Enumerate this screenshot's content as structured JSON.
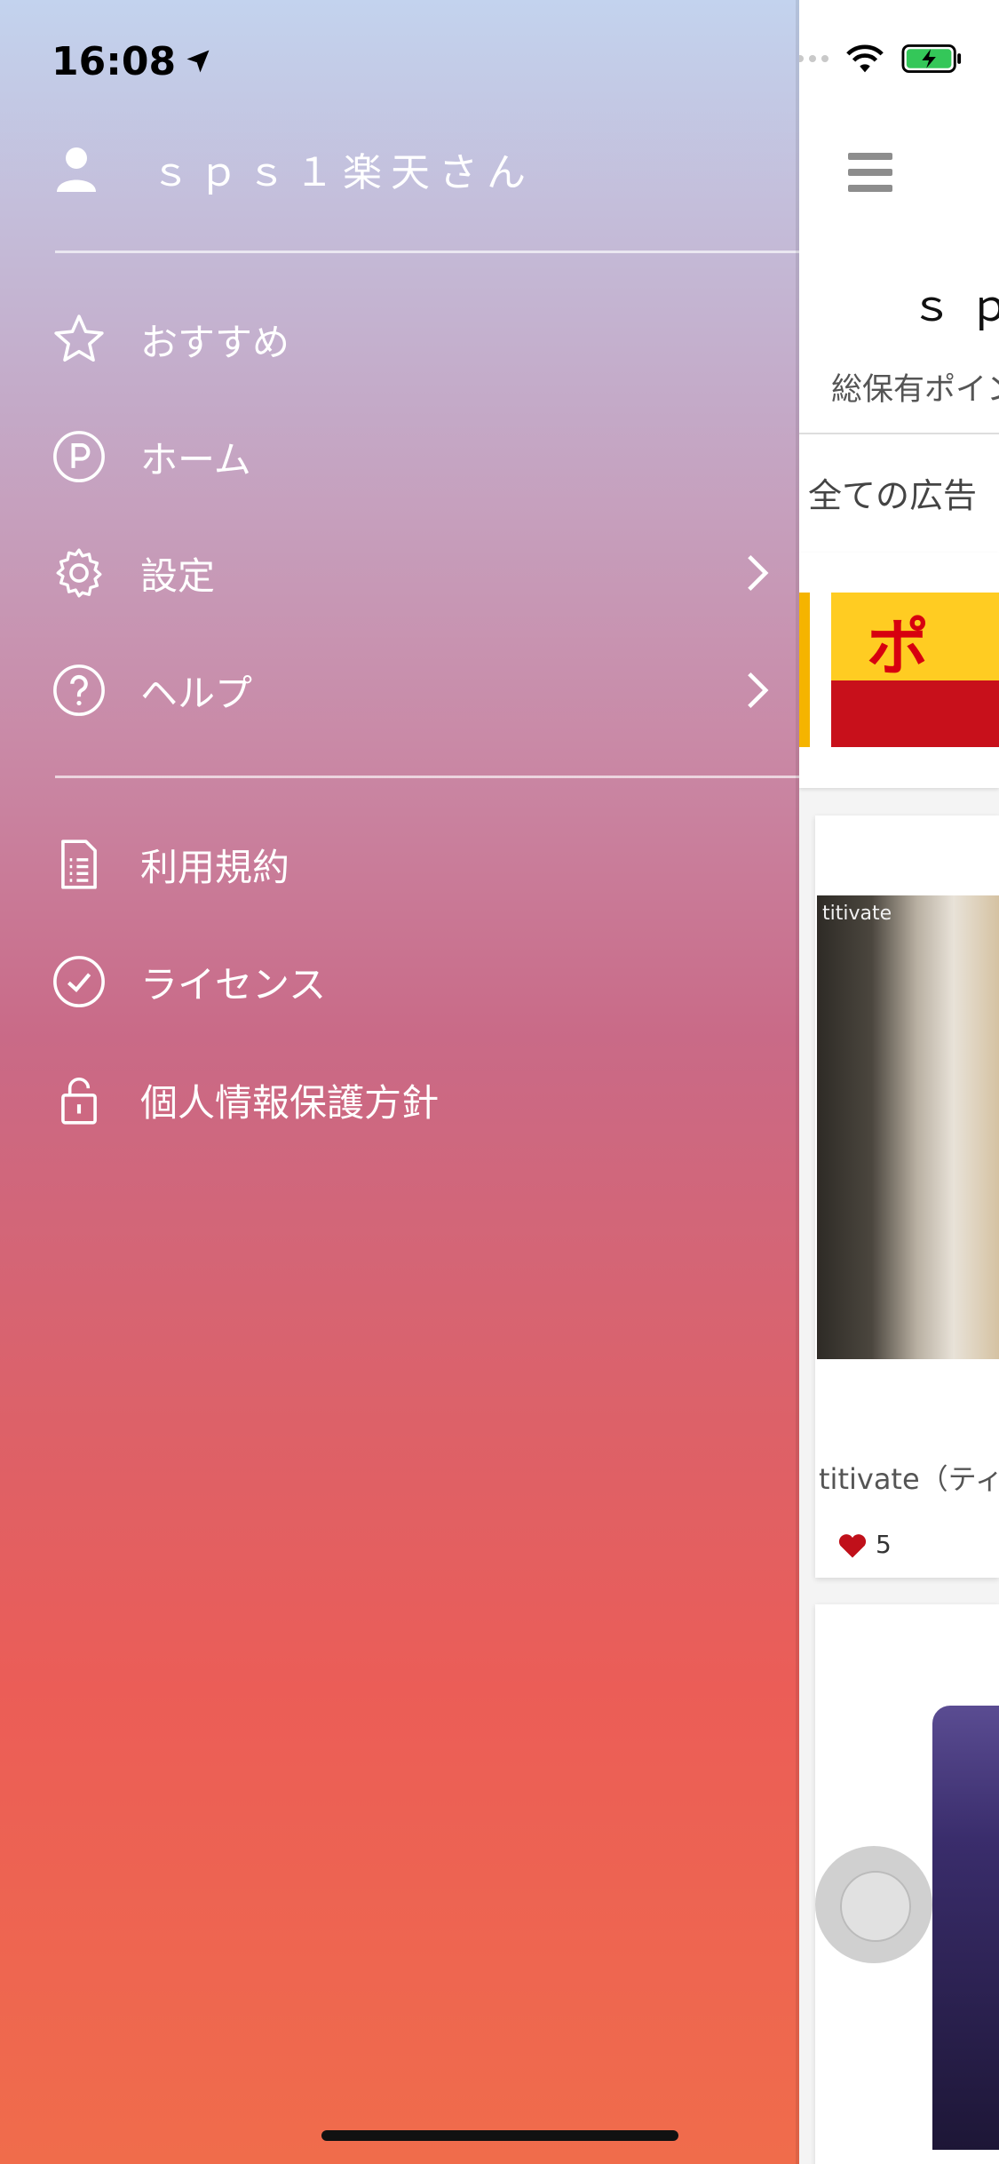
{
  "status_bar": {
    "time": "16:08"
  },
  "drawer": {
    "user_name": "ｓｐｓ１楽天さん",
    "menu": [
      {
        "label": "おすすめ",
        "icon": "star-icon",
        "chevron": false
      },
      {
        "label": "ホーム",
        "icon": "points-p-icon",
        "chevron": false
      },
      {
        "label": "設定",
        "icon": "gear-icon",
        "chevron": true
      },
      {
        "label": "ヘルプ",
        "icon": "help-icon",
        "chevron": true
      }
    ],
    "secondary_menu": [
      {
        "label": "利用規約",
        "icon": "document-icon"
      },
      {
        "label": "ライセンス",
        "icon": "check-circle-icon"
      },
      {
        "label": "個人情報保護方針",
        "icon": "lock-icon"
      }
    ]
  },
  "content": {
    "app_title": "ｓｐｓ",
    "points_label": "総保有ポイン",
    "filter_label": "全ての広告",
    "banner_text": "ポ",
    "card_brand": "titivate",
    "card_title": "titivate（ティ",
    "likes_count": "5"
  },
  "colors": {
    "gradient_top": "#c3d3ee",
    "gradient_bottom": "#f06c4b",
    "heart": "#c0101a",
    "banner_red": "#c8101b",
    "banner_yellow": "#ffcc22"
  }
}
